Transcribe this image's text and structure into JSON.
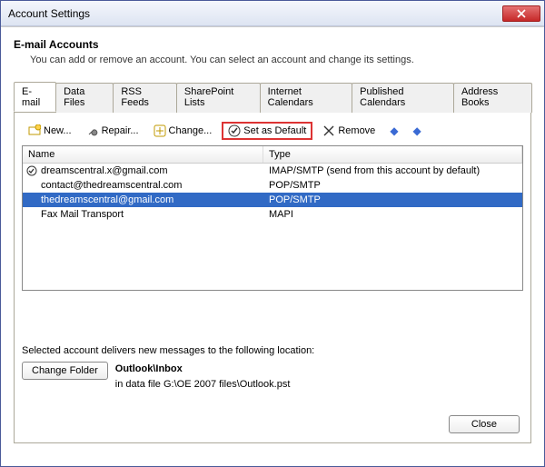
{
  "window": {
    "title": "Account Settings"
  },
  "header": {
    "heading": "E-mail Accounts",
    "subheading": "You can add or remove an account. You can select an account and change its settings."
  },
  "tabs": {
    "email": "E-mail",
    "datafiles": "Data Files",
    "rss": "RSS Feeds",
    "sharepoint": "SharePoint Lists",
    "internetcal": "Internet Calendars",
    "pubcal": "Published Calendars",
    "addressbooks": "Address Books"
  },
  "toolbar": {
    "new": "New...",
    "repair": "Repair...",
    "change": "Change...",
    "setdefault": "Set as Default",
    "remove": "Remove"
  },
  "columns": {
    "name": "Name",
    "type": "Type"
  },
  "accounts": [
    {
      "name": "dreamscentral.x@gmail.com",
      "type": "IMAP/SMTP (send from this account by default)",
      "default": true,
      "selected": false
    },
    {
      "name": "contact@thedreamscentral.com",
      "type": "POP/SMTP",
      "default": false,
      "selected": false
    },
    {
      "name": "thedreamscentral@gmail.com",
      "type": "POP/SMTP",
      "default": false,
      "selected": true
    },
    {
      "name": "Fax Mail Transport",
      "type": "MAPI",
      "default": false,
      "selected": false
    }
  ],
  "location": {
    "label": "Selected account delivers new messages to the following location:",
    "changefolder": "Change Folder",
    "folder": "Outlook\\Inbox",
    "datafile": "in data file G:\\OE 2007 files\\Outlook.pst"
  },
  "buttons": {
    "close": "Close"
  }
}
